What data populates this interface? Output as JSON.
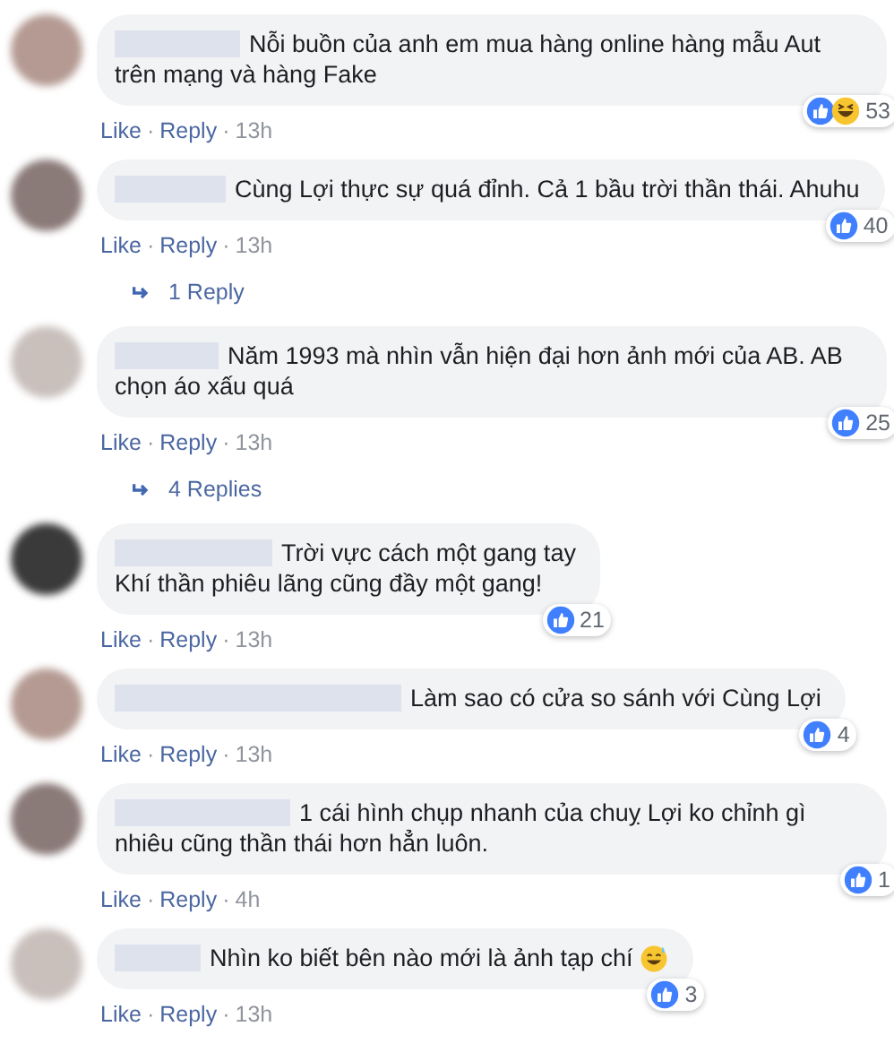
{
  "comments": [
    {
      "text": "Nỗi buồn của anh em mua hàng online hàng mẫu Aut trên mạng và hàng Fake",
      "reactions": [
        {
          "kind": "like"
        },
        {
          "kind": "haha"
        }
      ],
      "reaction_count": "53",
      "meta": [
        {
          "kind": "link",
          "text": "Like"
        },
        {
          "kind": "sep",
          "text": "·"
        },
        {
          "kind": "link",
          "text": "Reply"
        },
        {
          "kind": "sep",
          "text": "·"
        },
        {
          "kind": "time",
          "text": "13h"
        }
      ]
    },
    {
      "text": "Cùng Lợi thực sự quá đỉnh. Cả 1 bầu trời thần thái. Ahuhu",
      "reactions": [
        {
          "kind": "like"
        }
      ],
      "reaction_count": "40",
      "meta": [
        {
          "kind": "link",
          "text": "Like"
        },
        {
          "kind": "sep",
          "text": "·"
        },
        {
          "kind": "link",
          "text": "Reply"
        },
        {
          "kind": "sep",
          "text": "·"
        },
        {
          "kind": "time",
          "text": "13h"
        }
      ],
      "replies": "1 Reply"
    },
    {
      "text": "Năm 1993 mà nhìn vẫn hiện đại hơn ảnh mới của AB. AB chọn áo xấu quá",
      "reactions": [
        {
          "kind": "like"
        }
      ],
      "reaction_count": "25",
      "meta": [
        {
          "kind": "link",
          "text": "Like"
        },
        {
          "kind": "sep",
          "text": "·"
        },
        {
          "kind": "link",
          "text": "Reply"
        },
        {
          "kind": "sep",
          "text": "·"
        },
        {
          "kind": "time",
          "text": "13h"
        }
      ],
      "replies": "4 Replies"
    },
    {
      "text": "Trời vực cách một gang tay\nKhí thần phiêu lãng cũng đầy một gang!",
      "reactions": [
        {
          "kind": "like"
        }
      ],
      "reaction_count": "21",
      "meta": [
        {
          "kind": "link",
          "text": "Like"
        },
        {
          "kind": "sep",
          "text": "·"
        },
        {
          "kind": "link",
          "text": "Reply"
        },
        {
          "kind": "sep",
          "text": "·"
        },
        {
          "kind": "time",
          "text": "13h"
        }
      ]
    },
    {
      "text": "Làm sao có cửa so sánh với Cùng Lợi",
      "reactions": [
        {
          "kind": "like"
        }
      ],
      "reaction_count": "4",
      "meta": [
        {
          "kind": "link",
          "text": "Like"
        },
        {
          "kind": "sep",
          "text": "·"
        },
        {
          "kind": "link",
          "text": "Reply"
        },
        {
          "kind": "sep",
          "text": "·"
        },
        {
          "kind": "time",
          "text": "13h"
        }
      ]
    },
    {
      "text": "1 cái hình chụp nhanh của chuỵ Lợi ko chỉnh gì nhiêu cũng thần thái hơn hẳn luôn.",
      "reactions": [
        {
          "kind": "like"
        }
      ],
      "reaction_count": "1",
      "meta": [
        {
          "kind": "link",
          "text": "Like"
        },
        {
          "kind": "sep",
          "text": "·"
        },
        {
          "kind": "link",
          "text": "Reply"
        },
        {
          "kind": "sep",
          "text": "·"
        },
        {
          "kind": "time",
          "text": "4h"
        }
      ]
    },
    {
      "text": "Nhìn ko biết bên nào mới là ảnh tạp chí",
      "emoji": {
        "kind": "grin-sweat"
      },
      "reactions": [
        {
          "kind": "like"
        }
      ],
      "reaction_count": "3",
      "meta": [
        {
          "kind": "link",
          "text": "Like"
        },
        {
          "kind": "sep",
          "text": "·"
        },
        {
          "kind": "link",
          "text": "Reply"
        },
        {
          "kind": "sep",
          "text": "·"
        },
        {
          "kind": "time",
          "text": "13h"
        }
      ]
    }
  ]
}
